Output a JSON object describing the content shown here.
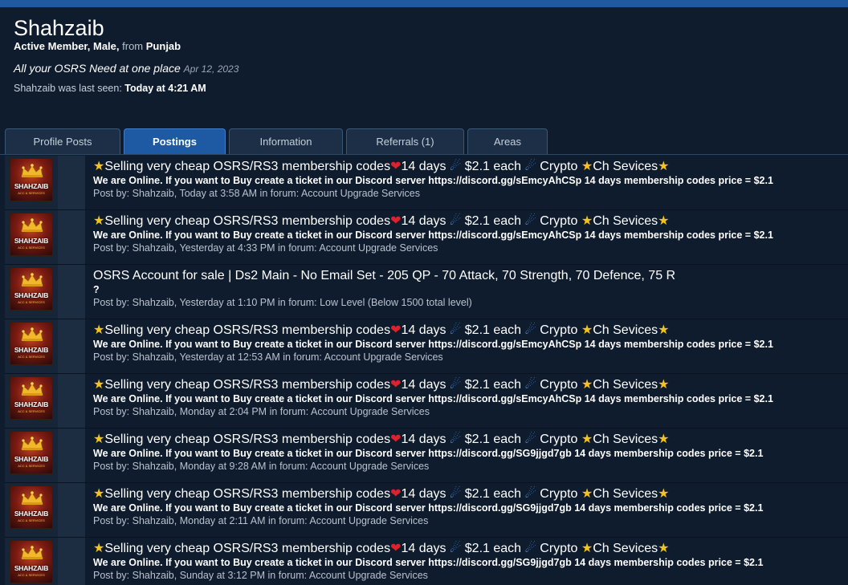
{
  "profile": {
    "username": "Shahzaib",
    "title": "Active Member",
    "gender": "Male",
    "from_label": "from",
    "location": "Punjab",
    "status_text": "All your OSRS Need at one place",
    "status_date": "Apr 12, 2023",
    "last_seen_label": "Shahzaib was last seen:",
    "last_seen_value": "Today at 4:21 AM"
  },
  "tabs": [
    {
      "label": "Profile Posts",
      "width": 144,
      "active": false
    },
    {
      "label": "Postings",
      "width": 127,
      "active": true
    },
    {
      "label": "Information",
      "width": 142,
      "active": false
    },
    {
      "label": "Referrals (1)",
      "width": 147,
      "active": false
    },
    {
      "label": "Areas",
      "width": 100,
      "active": false
    }
  ],
  "avatar_text": {
    "main": "SHAHZAIB",
    "sub": "ACC & SERVICES"
  },
  "posts": [
    {
      "title": "Selling very cheap OSRS/RS3 membership codes",
      "title_tail": "14 days",
      "price": "$2.1 each",
      "crypto": "Crypto",
      "ch": "Ch Sevices",
      "desc": "We are Online. If you want to Buy create a ticket in our Discord server https://discord.gg/sEmcyAhCSp 14 days membership codes price = $2.1",
      "meta": "Post by: Shahzaib, Today at 3:58 AM in forum: Account Upgrade Services",
      "fancy": true
    },
    {
      "title": "Selling very cheap OSRS/RS3 membership codes",
      "title_tail": "14 days",
      "price": "$2.1 each",
      "crypto": "Crypto",
      "ch": "Ch Sevices",
      "desc": "We are Online. If you want to Buy create a ticket in our Discord server https://discord.gg/sEmcyAhCSp 14 days membership codes price = $2.1",
      "meta": "Post by: Shahzaib, Yesterday at 4:33 PM in forum: Account Upgrade Services",
      "fancy": true
    },
    {
      "title": "OSRS Account for sale | Ds2 Main - No Email Set - 205 QP - 70 Attack, 70 Strength, 70 Defence, 75 R",
      "desc": "?",
      "meta": "Post by: Shahzaib, Yesterday at 1:10 PM in forum: Low Level (Below 1500 total level)",
      "fancy": false
    },
    {
      "title": "Selling very cheap OSRS/RS3 membership codes",
      "title_tail": "14 days",
      "price": "$2.1 each",
      "crypto": "Crypto",
      "ch": "Ch Sevices",
      "desc": "We are Online. If you want to Buy create a ticket in our Discord server https://discord.gg/sEmcyAhCSp 14 days membership codes price = $2.1",
      "meta": "Post by: Shahzaib, Yesterday at 12:53 AM in forum: Account Upgrade Services",
      "fancy": true
    },
    {
      "title": "Selling very cheap OSRS/RS3 membership codes",
      "title_tail": "14 days",
      "price": "$2.1 each",
      "crypto": "Crypto",
      "ch": "Ch Sevices",
      "desc": "We are Online. If you want to Buy create a ticket in our Discord server https://discord.gg/sEmcyAhCSp 14 days membership codes price = $2.1",
      "meta": "Post by: Shahzaib, Monday at 2:04 PM in forum: Account Upgrade Services",
      "fancy": true
    },
    {
      "title": "Selling very cheap OSRS/RS3 membership codes",
      "title_tail": "14 days",
      "price": "$2.1 each",
      "crypto": "Crypto",
      "ch": "Ch Sevices",
      "desc": "We are Online. If you want to Buy create a ticket in our Discord server https://discord.gg/SG9jjgd7gb 14 days membership codes price = $2.1",
      "meta": "Post by: Shahzaib, Monday at 9:28 AM in forum: Account Upgrade Services",
      "fancy": true
    },
    {
      "title": "Selling very cheap OSRS/RS3 membership codes",
      "title_tail": "14 days",
      "price": "$2.1 each",
      "crypto": "Crypto",
      "ch": "Ch Sevices",
      "desc": "We are Online. If you want to Buy create a ticket in our Discord server https://discord.gg/SG9jjgd7gb 14 days membership codes price = $2.1",
      "meta": "Post by: Shahzaib, Monday at 2:11 AM in forum: Account Upgrade Services",
      "fancy": true
    },
    {
      "title": "Selling very cheap OSRS/RS3 membership codes",
      "title_tail": "14 days",
      "price": "$2.1 each",
      "crypto": "Crypto",
      "ch": "Ch Sevices",
      "desc": "We are Online. If you want to Buy create a ticket in our Discord server https://discord.gg/SG9jjgd7gb 14 days membership codes price = $2.1",
      "meta": "Post by: Shahzaib, Sunday at 3:12 PM in forum: Account Upgrade Services",
      "fancy": true
    }
  ],
  "icons": {
    "star": "star-icon",
    "heart": "heart-icon",
    "comet": "comet-icon",
    "crown": "crown-icon"
  },
  "colors": {
    "background": "#0f1c2e",
    "active_tab": "#1e5aa4",
    "star": "#f3c320",
    "heart": "#e0202a",
    "comet": "#4a8fe0"
  }
}
